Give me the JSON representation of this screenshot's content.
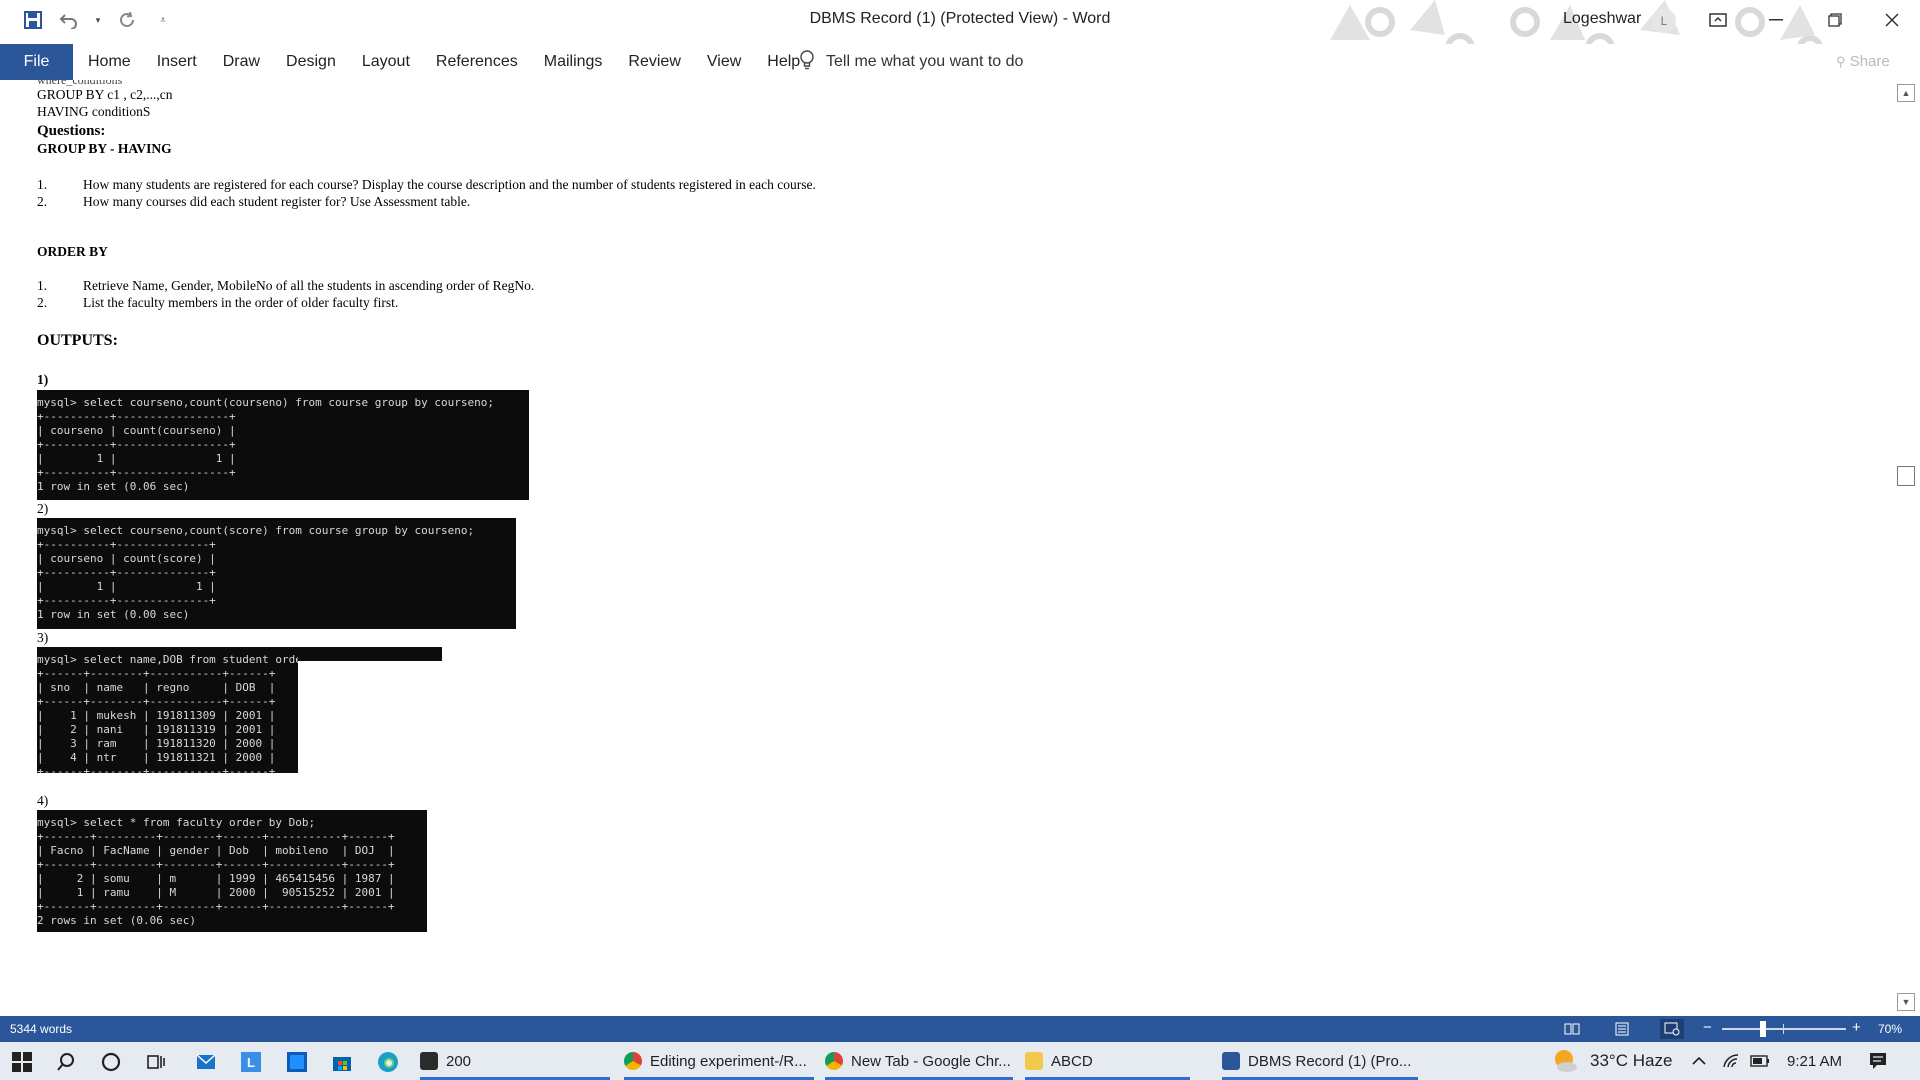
{
  "titlebar": {
    "doc_title": "DBMS Record (1) (Protected View)  -  Word",
    "user_name": "Logeshwar",
    "avatar_initial": "L",
    "qat_icons": [
      "save-icon",
      "undo-icon",
      "redo-icon",
      "customize-qat-icon"
    ]
  },
  "ribbon": {
    "file_label": "File",
    "tabs": [
      "Home",
      "Insert",
      "Draw",
      "Design",
      "Layout",
      "References",
      "Mailings",
      "Review",
      "View",
      "Help"
    ],
    "tell_me": "Tell me what you want to do",
    "share_label": "Share"
  },
  "document": {
    "cut_line": "where_conditions",
    "group_by_line": "GROUP BY c1 , c2,...,cn",
    "having_line": "HAVING conditionS",
    "questions_label": "Questions:",
    "section1_heading": "GROUP BY - HAVING",
    "section1_items": [
      {
        "num": "1.",
        "text": "How many students are registered for each course? Display the course description and the number of students registered in each course."
      },
      {
        "num": "2.",
        "text": "How many courses did each student register for? Use Assessment table."
      }
    ],
    "section2_heading": "ORDER BY",
    "section2_items": [
      {
        "num": "1.",
        "text": "Retrieve Name, Gender, MobileNo of all the students in ascending order of RegNo."
      },
      {
        "num": "2.",
        "text": "List the faculty members in the order of older faculty first."
      }
    ],
    "outputs_heading": "OUTPUTS:",
    "outputs": [
      {
        "label": "1)",
        "lines": [
          "mysql> select courseno,count(courseno) from course group by courseno;",
          "+----------+-----------------+",
          "| courseno | count(courseno) |",
          "+----------+-----------------+",
          "|        1 |               1 |",
          "+----------+-----------------+",
          "1 row in set (0.06 sec)"
        ]
      },
      {
        "label": "2)",
        "lines": [
          "mysql> select courseno,count(score) from course group by courseno;",
          "+----------+--------------+",
          "| courseno | count(score) |",
          "+----------+--------------+",
          "|        1 |            1 |",
          "+----------+--------------+",
          "1 row in set (0.00 sec)"
        ]
      },
      {
        "label": "3)",
        "lines": [
          "mysql> select name,DOB from student order by regno;",
          "+------+--------+-----------+------+",
          "| sno  | name   | regno     | DOB  |",
          "+------+--------+-----------+------+",
          "|    1 | mukesh | 191811309 | 2001 |",
          "|    2 | nani   | 191811319 | 2001 |",
          "|    3 | ram    | 191811320 | 2000 |",
          "|    4 | ntr    | 191811321 | 2000 |",
          "+------+--------+-----------+------+"
        ]
      },
      {
        "label": "4)",
        "lines": [
          "mysql> select * from faculty order by Dob;",
          "+-------+---------+--------+------+-----------+------+",
          "| Facno | FacName | gender | Dob  | mobileno  | DOJ  |",
          "+-------+---------+--------+------+-----------+------+",
          "|     2 | somu    | m      | 1999 | 465415456 | 1987 |",
          "|     1 | ramu    | M      | 2000 |  90515252 | 2001 |",
          "+-------+---------+--------+------+-----------+------+",
          "2 rows in set (0.06 sec)"
        ]
      }
    ]
  },
  "statusbar": {
    "word_count": "5344 words",
    "zoom_level": "70%",
    "zoom_minus": "−",
    "zoom_plus": "+",
    "zoom_fraction": 0.7
  },
  "taskbar": {
    "apps": [
      {
        "label": "200",
        "icon": "cmd-icon",
        "color": "#2b2b2b"
      },
      {
        "label": "Editing experiment-/R...",
        "icon": "chrome-icon",
        "color": "#db4437"
      },
      {
        "label": "New Tab - Google Chr...",
        "icon": "chrome-icon",
        "color": "#db4437"
      },
      {
        "label": "ABCD",
        "icon": "folder-icon",
        "color": "#f2c94c"
      },
      {
        "label": "DBMS Record (1) (Pro...",
        "icon": "word-icon",
        "color": "#2b579a"
      }
    ],
    "weather": "33°C  Haze",
    "time": "9:21 AM"
  },
  "colors": {
    "word_blue": "#2b579a",
    "terminal_bg": "#0c0c0c",
    "taskbar_bg": "#e6ebf2"
  }
}
